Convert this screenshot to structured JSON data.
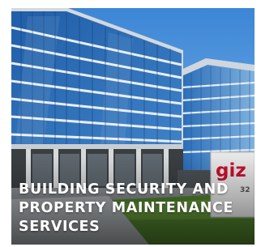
{
  "card": {
    "image_alt": "Office building",
    "sign_logo": "giz",
    "sign_number": "32",
    "caption": "BUILDING SECURITY AND PROPERTY MAINTENANCE SERVICES"
  },
  "colors": {
    "sky": "#4a8fd8",
    "glass": "#2f6fc0",
    "facade": "#d9dde2",
    "lawn": "#5a8a34",
    "sign_red": "#c8102e",
    "caption_text": "#ffffff"
  }
}
